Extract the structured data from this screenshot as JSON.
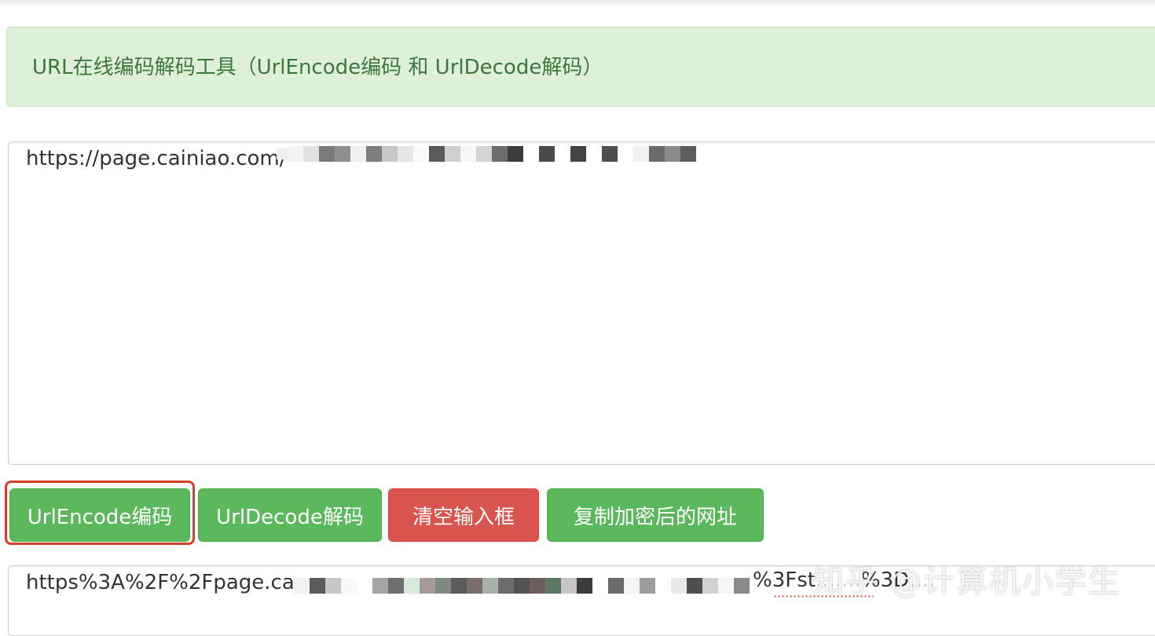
{
  "header": {
    "title": "URL在线编码解码工具（UrlEncode编码 和 UrlDecode解码）"
  },
  "input": {
    "value": "https://page.cainiao.com/"
  },
  "buttons": {
    "encode": "UrlEncode编码",
    "decode": "UrlDecode解码",
    "clear": "清空输入框",
    "copy": "复制加密后的网址"
  },
  "output": {
    "value": "https%3A%2F%2Fpage.ca",
    "tail": "%3Fst",
    "tail_obscured": "%3D"
  },
  "watermark": {
    "text": "知乎 @计算机小学生"
  },
  "colors": {
    "success": "#5cb85c",
    "danger": "#d9534f",
    "heading_bg": "#dff0d8",
    "heading_text": "#3c763d",
    "focus_ring": "#d0402b"
  }
}
